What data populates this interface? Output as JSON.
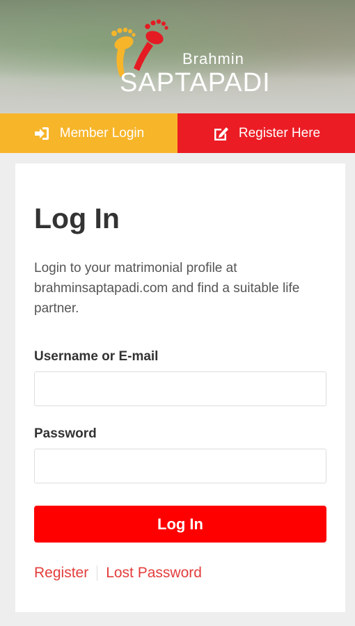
{
  "brand": {
    "small": "Brahmin",
    "big": "SAPTAPADI",
    "logo_icon": "footprints-icon",
    "colors": {
      "foot_yellow": "#f7b52a",
      "foot_red": "#e41b22"
    }
  },
  "nav": {
    "member_login": "Member Login",
    "member_login_icon": "sign-in-icon",
    "register": "Register Here",
    "register_icon": "edit-icon"
  },
  "form": {
    "title": "Log In",
    "description": "Login to your matrimonial profile at brahminsaptapadi.com and find a suitable life partner.",
    "username_label": "Username or E-mail",
    "username_value": "",
    "password_label": "Password",
    "password_value": "",
    "submit_label": "Log In"
  },
  "links": {
    "register": "Register",
    "lost_password": "Lost Password"
  },
  "colors": {
    "login_tab": "#f7b52a",
    "register_tab": "#ec1c24",
    "submit_button": "#ff0000",
    "link": "#e43c3c"
  }
}
